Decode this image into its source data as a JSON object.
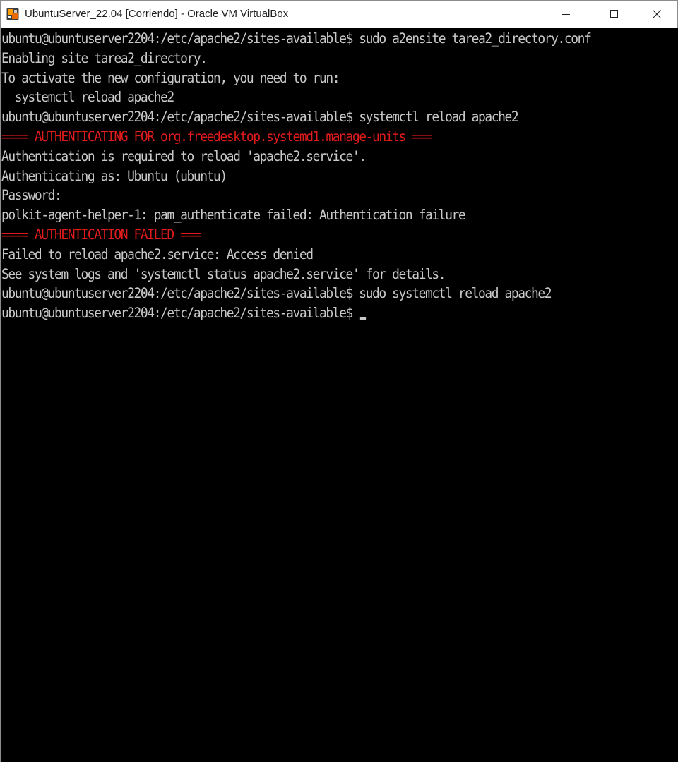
{
  "window": {
    "title": "UbuntuServer_22.04 [Corriendo] - Oracle VM VirtualBox",
    "icon": "virtualbox-icon",
    "controls": {
      "minimize": "minimize-icon",
      "maximize": "maximize-icon",
      "close": "close-icon"
    }
  },
  "colors": {
    "terminal_bg": "#000000",
    "terminal_fg": "#c8c8c8",
    "error_red": "#e01b1b"
  },
  "terminal": {
    "lines": [
      {
        "text": "ubuntu@ubuntuserver2204:/etc/apache2/sites-available$ sudo a2ensite tarea2_directory.conf",
        "style": "normal"
      },
      {
        "text": "Enabling site tarea2_directory.",
        "style": "normal"
      },
      {
        "text": "To activate the new configuration, you need to run:",
        "style": "normal"
      },
      {
        "text": "  systemctl reload apache2",
        "style": "normal"
      },
      {
        "text": "ubuntu@ubuntuserver2204:/etc/apache2/sites-available$ systemctl reload apache2",
        "style": "normal"
      },
      {
        "text": "==== AUTHENTICATING FOR org.freedesktop.systemd1.manage-units ===",
        "style": "red"
      },
      {
        "text": "Authentication is required to reload 'apache2.service'.",
        "style": "normal"
      },
      {
        "text": "Authenticating as: Ubuntu (ubuntu)",
        "style": "normal"
      },
      {
        "text": "Password:",
        "style": "normal"
      },
      {
        "text": "polkit-agent-helper-1: pam_authenticate failed: Authentication failure",
        "style": "normal"
      },
      {
        "text": "==== AUTHENTICATION FAILED ===",
        "style": "red"
      },
      {
        "text": "Failed to reload apache2.service: Access denied",
        "style": "normal"
      },
      {
        "text": "See system logs and 'systemctl status apache2.service' for details.",
        "style": "normal"
      },
      {
        "text": "ubuntu@ubuntuserver2204:/etc/apache2/sites-available$ sudo systemctl reload apache2",
        "style": "normal"
      },
      {
        "text": "ubuntu@ubuntuserver2204:/etc/apache2/sites-available$ ",
        "style": "normal",
        "cursor": true
      }
    ]
  }
}
